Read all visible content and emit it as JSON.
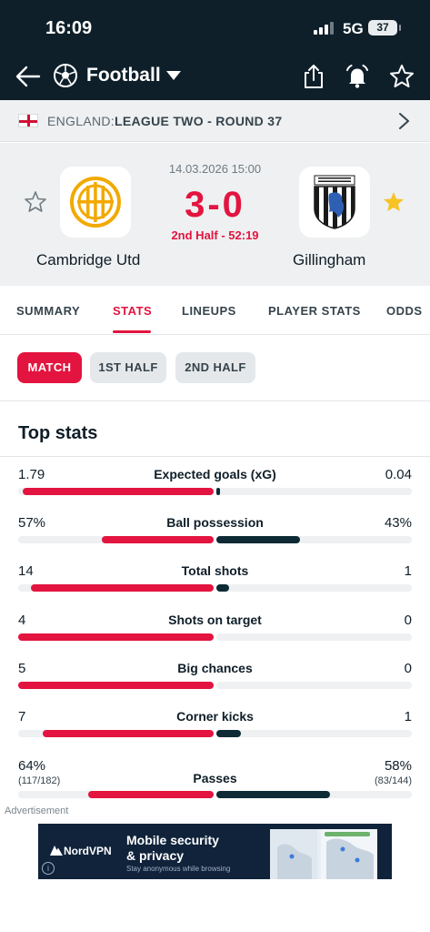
{
  "status_bar": {
    "time": "16:09",
    "network": "5G",
    "battery": "37"
  },
  "header": {
    "sport": "Football",
    "icons": [
      "back-arrow-icon",
      "football-icon",
      "share-icon",
      "alarm-bell-icon",
      "star-icon"
    ]
  },
  "league": {
    "country": "ENGLAND:",
    "name": "LEAGUE TWO - ROUND 37"
  },
  "match": {
    "datetime": "14.03.2026 15:00",
    "score": "3-0",
    "state": "2nd Half - 52:19",
    "home_team": "Cambridge Utd",
    "away_team": "Gillingham",
    "home_favorite": false,
    "away_favorite": true,
    "colors": {
      "score": "#e3143f",
      "home_badge": "#f2a900",
      "away_badge": "#1a1a1a"
    }
  },
  "tabs": [
    "SUMMARY",
    "STATS",
    "LINEUPS",
    "PLAYER STATS",
    "ODDS"
  ],
  "active_tab": "STATS",
  "periods": [
    "MATCH",
    "1ST HALF",
    "2ND HALF"
  ],
  "active_period": "MATCH",
  "top_stats": {
    "title": "Top stats",
    "rows": [
      {
        "label": "Expected goals (xG)",
        "home": "1.79",
        "away": "0.04",
        "home_value": 1.79,
        "away_value": 0.04
      },
      {
        "label": "Ball possession",
        "home": "57%",
        "away": "43%",
        "home_value": 57,
        "away_value": 43
      },
      {
        "label": "Total shots",
        "home": "14",
        "away": "1",
        "home_value": 14,
        "away_value": 1
      },
      {
        "label": "Shots on target",
        "home": "4",
        "away": "0",
        "home_value": 4,
        "away_value": 0
      },
      {
        "label": "Big chances",
        "home": "5",
        "away": "0",
        "home_value": 5,
        "away_value": 0
      },
      {
        "label": "Corner kicks",
        "home": "7",
        "away": "1",
        "home_value": 7,
        "away_value": 1
      },
      {
        "label": "Passes",
        "home": "64%",
        "away": "58%",
        "home_sub": "(117/182)",
        "away_sub": "(83/144)",
        "home_value": 64,
        "away_value": 58
      }
    ],
    "colors": {
      "home": "#e3143f",
      "away": "#0e2b35"
    }
  },
  "ad": {
    "label": "Advertisement",
    "brand": "NordVPN",
    "headline_1": "Mobile security",
    "headline_2": "& privacy",
    "tagline": "Stay anonymous while browsing"
  }
}
